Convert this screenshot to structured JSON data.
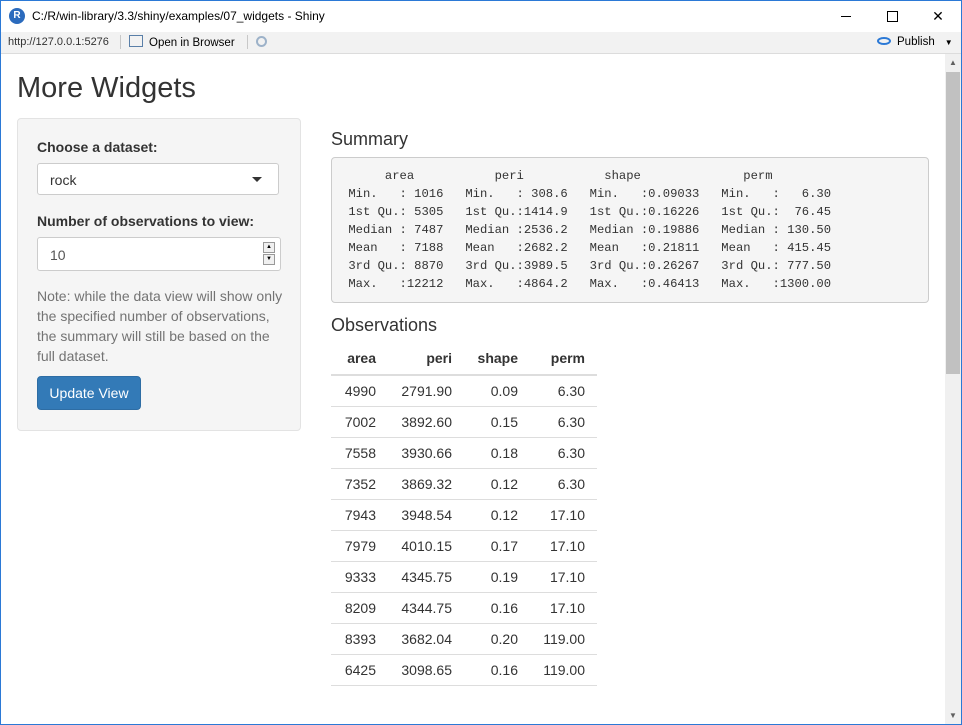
{
  "window": {
    "title": "C:/R/win-library/3.3/shiny/examples/07_widgets - Shiny",
    "logo_letter": "R"
  },
  "toolbar": {
    "url": "http://127.0.0.1:5276",
    "open_browser_label": "Open in Browser",
    "publish_label": "Publish"
  },
  "page": {
    "title": "More Widgets"
  },
  "sidebar": {
    "dataset_label": "Choose a dataset:",
    "dataset_value": "rock",
    "obs_label": "Number of observations to view:",
    "obs_value": "10",
    "note": "Note: while the data view will show only the specified number of observations, the summary will still be based on the full dataset.",
    "update_button": "Update View"
  },
  "summary": {
    "heading": "Summary",
    "text": "      area           peri           shape              perm        \n Min.   : 1016   Min.   : 308.6   Min.   :0.09033   Min.   :   6.30  \n 1st Qu.: 5305   1st Qu.:1414.9   1st Qu.:0.16226   1st Qu.:  76.45  \n Median : 7487   Median :2536.2   Median :0.19886   Median : 130.50  \n Mean   : 7188   Mean   :2682.2   Mean   :0.21811   Mean   : 415.45  \n 3rd Qu.: 8870   3rd Qu.:3989.5   3rd Qu.:0.26267   3rd Qu.: 777.50  \n Max.   :12212   Max.   :4864.2   Max.   :0.46413   Max.   :1300.00  "
  },
  "observations": {
    "heading": "Observations",
    "columns": [
      "area",
      "peri",
      "shape",
      "perm"
    ],
    "rows": [
      [
        "4990",
        "2791.90",
        "0.09",
        "6.30"
      ],
      [
        "7002",
        "3892.60",
        "0.15",
        "6.30"
      ],
      [
        "7558",
        "3930.66",
        "0.18",
        "6.30"
      ],
      [
        "7352",
        "3869.32",
        "0.12",
        "6.30"
      ],
      [
        "7943",
        "3948.54",
        "0.12",
        "17.10"
      ],
      [
        "7979",
        "4010.15",
        "0.17",
        "17.10"
      ],
      [
        "9333",
        "4345.75",
        "0.19",
        "17.10"
      ],
      [
        "8209",
        "4344.75",
        "0.16",
        "17.10"
      ],
      [
        "8393",
        "3682.04",
        "0.20",
        "119.00"
      ],
      [
        "6425",
        "3098.65",
        "0.16",
        "119.00"
      ]
    ]
  },
  "icons": {
    "browser": "browser-window-icon",
    "refresh": "refresh-icon",
    "publish": "publish-icon",
    "select_caret": "caret-down-icon",
    "close_glyph": "✕"
  },
  "colors": {
    "button": "#337ab7",
    "well": "#f5f5f5",
    "window_border": "#2b79d6"
  }
}
